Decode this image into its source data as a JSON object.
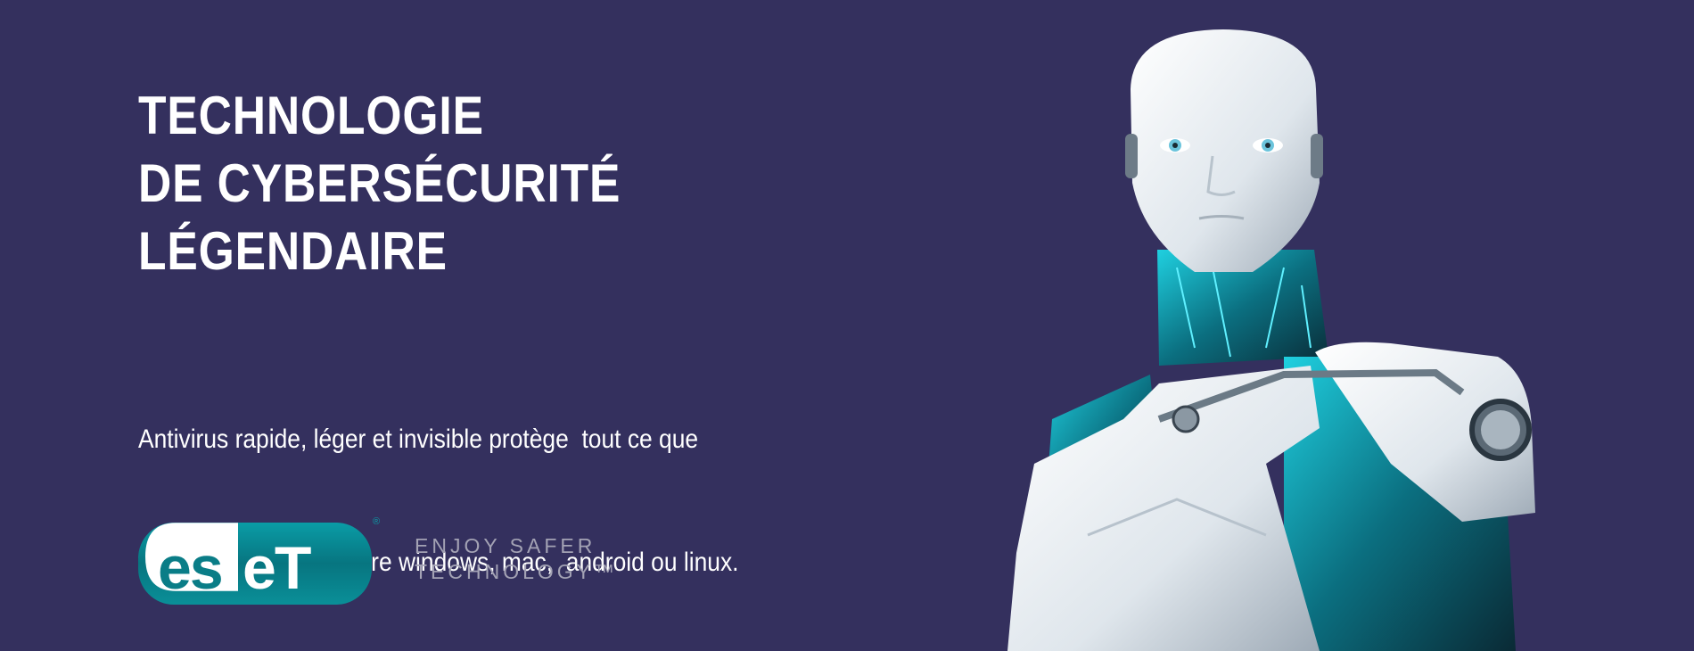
{
  "banner": {
    "headline_lines": [
      "TECHNOLOGIE",
      "DE CYBERSÉCURITÉ",
      "LÉGENDAIRE"
    ],
    "subtitle_lines": [
      "Antivirus rapide, léger et invisible protège  tout ce que",
      "vous chérissez sur votre windows, mac,  android ou linux."
    ],
    "logo": {
      "text": "eset",
      "registered": "®"
    },
    "tagline_lines": [
      "ENJOY SAFER",
      "TECHNOLOGY™"
    ],
    "colors": {
      "background": "#34305e",
      "brand_teal": "#0a8a94",
      "text": "#ffffff",
      "tagline": "#a3a2b4"
    }
  }
}
